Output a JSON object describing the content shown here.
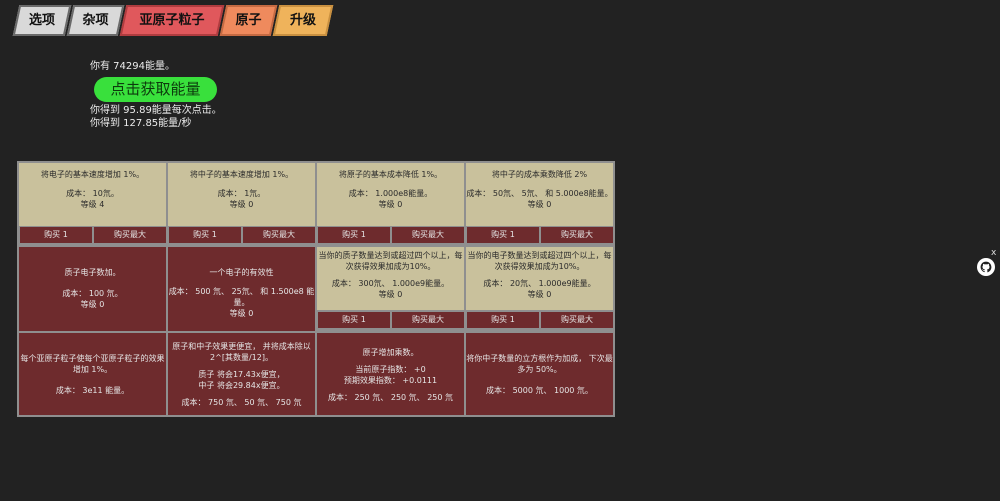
{
  "tabs": [
    {
      "label": "选项"
    },
    {
      "label": "杂项"
    },
    {
      "label": "亚原子粒子"
    },
    {
      "label": "原子"
    },
    {
      "label": "升级"
    }
  ],
  "energy": {
    "have": "你有 74294能量。",
    "button": "点击获取能量",
    "per_click": "你得到 95.89能量每次点击。",
    "per_sec": "你得到 127.85能量/秒"
  },
  "grid": {
    "row1": [
      {
        "title": "将电子的基本速度增加 1%。",
        "cost": "成本： 10氘。",
        "level": "等级 4",
        "buy1": "购买 1",
        "buymax": "购买最大"
      },
      {
        "title": "将中子的基本速度增加 1%。",
        "cost": "成本： 1氘。",
        "level": "等级 0",
        "buy1": "购买 1",
        "buymax": "购买最大"
      },
      {
        "title": "将原子的基本成本降低 1%。",
        "cost": "成本： 1.000e8能量。",
        "level": "等级 0",
        "buy1": "购买 1",
        "buymax": "购买最大"
      },
      {
        "title": "将中子的成本乘数降低 2%",
        "cost": "成本： 50氘、 5氘、 和 5.000e8能量。",
        "level": "等级 0",
        "buy1": "购买 1",
        "buymax": "购买最大"
      }
    ],
    "row2": [
      {
        "title": "质子电子数加。",
        "cost": "成本： 100 氘。",
        "level": "等级 0"
      },
      {
        "title": "一个电子的有效性",
        "cost": "成本： 500 氘、 25氘、 和 1.500e8 能量。",
        "level": "等级 0"
      },
      {
        "title": "当你的质子数量达到或超过四个以上，每次获得效果加成为10%。",
        "cost": "成本： 300氘、 1.000e9能量。",
        "level": "等级 0",
        "buy1": "购买 1",
        "buymax": "购买最大"
      },
      {
        "title": "当你的电子数量达到或超过四个以上，每次获得效果加成为10%。",
        "cost": "成本： 20氘、 1.000e9能量。",
        "level": "等级 0",
        "buy1": "购买 1",
        "buymax": "购买最大"
      }
    ],
    "row3": [
      {
        "title": "每个亚原子粒子使每个亚原子粒子的效果增加 1%。",
        "cost": "成本： 3e11 能量。"
      },
      {
        "title": "原子和中子效果更便宜， 并将成本除以 2^[其数量/12]。",
        "line2": "质子 将会17.43x便宜，",
        "line3": "中子 将会29.84x便宜。",
        "cost": "成本： 750 氘、 50 氘、 750 氘"
      },
      {
        "title": "原子增加乘数。",
        "line2": "当前原子指数： +0",
        "line3": "预期效果指数： +0.0111",
        "cost": "成本： 250 氘、 250 氘、 250 氘"
      },
      {
        "title": "将你中子数量的立方根作为加成， 下次最多为 50%。",
        "cost": "成本： 5000 氘、 1000 氘。"
      }
    ]
  },
  "side": {
    "close": "x",
    "icon": "github-icon"
  }
}
